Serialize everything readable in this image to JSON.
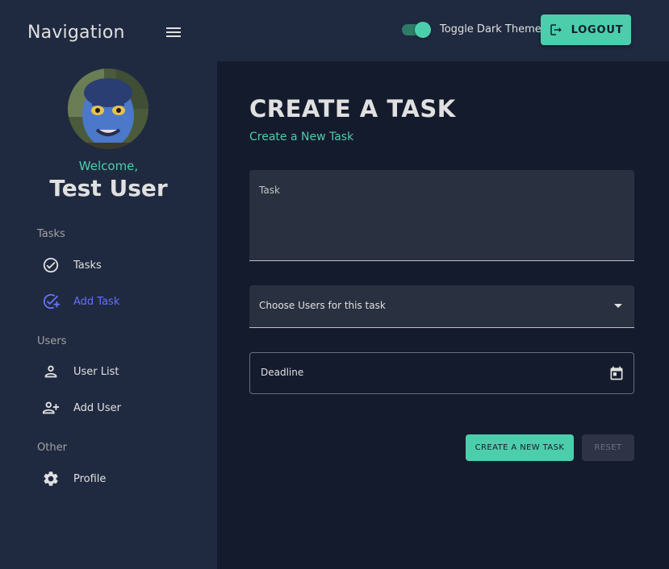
{
  "header": {
    "nav_title": "Navigation",
    "toggle_label": "Toggle Dark Theme",
    "logout_label": "LOGOUT"
  },
  "sidebar": {
    "welcome": "Welcome,",
    "username": "Test User",
    "sections": [
      {
        "label": "Tasks",
        "items": [
          {
            "label": "Tasks",
            "icon": "check-circle-icon"
          },
          {
            "label": "Add Task",
            "icon": "add-task-icon",
            "active": true
          }
        ]
      },
      {
        "label": "Users",
        "items": [
          {
            "label": "User List",
            "icon": "person-icon"
          },
          {
            "label": "Add User",
            "icon": "person-add-icon"
          }
        ]
      },
      {
        "label": "Other",
        "items": [
          {
            "label": "Profile",
            "icon": "gear-icon"
          }
        ]
      }
    ]
  },
  "main": {
    "title": "CREATE A TASK",
    "subtitle": "Create a New Task",
    "task_label": "Task",
    "users_label": "Choose Users for this task",
    "deadline_label": "Deadline",
    "create_button": "CREATE A NEW TASK",
    "reset_button": "RESET"
  },
  "colors": {
    "background": "#141b2d",
    "panel": "#1f2a40",
    "accent": "#4cceac",
    "active_nav": "#6870fa",
    "field": "#293040"
  }
}
